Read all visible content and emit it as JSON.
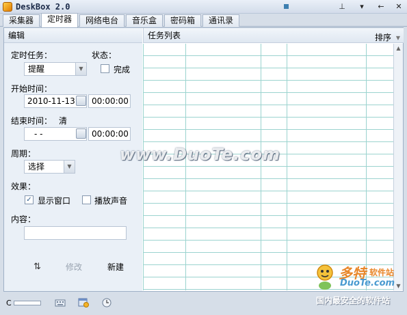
{
  "window": {
    "title": "DeskBox 2.0"
  },
  "tabs": [
    {
      "label": "采集器"
    },
    {
      "label": "定时器"
    },
    {
      "label": "网络电台"
    },
    {
      "label": "音乐盒"
    },
    {
      "label": "密码箱"
    },
    {
      "label": "通讯录"
    }
  ],
  "active_tab": "定时器",
  "edit_panel": {
    "header": "编辑",
    "task_label": "定时任务：",
    "task_value": "提醒",
    "status_label": "状态：",
    "done_label": "完成",
    "done_checked": false,
    "start_label": "开始时间：",
    "start_date": "2010-11-13",
    "start_time": "00:00:00",
    "end_label": "结束时间：",
    "end_clear": "清",
    "end_date": "- -",
    "end_time": "00:00:00",
    "period_label": "周期：",
    "period_value": "选择",
    "effect_label": "效果：",
    "show_window_label": "显示窗口",
    "show_window_checked": true,
    "play_sound_label": "播放声音",
    "play_sound_checked": false,
    "content_label": "内容：",
    "content_value": "",
    "modify_label": "修改",
    "new_label": "新建"
  },
  "task_list": {
    "header": "任务列表",
    "sort_label": "排序",
    "rows": 20
  },
  "watermarks": {
    "center": "www.DuoTe.com",
    "brand_cn": "多特",
    "brand_soft": "软件站",
    "brand_url": "DuoTe.com",
    "slogan": "国内最安全的软件站"
  },
  "statusbar": {
    "c_label": "C"
  }
}
